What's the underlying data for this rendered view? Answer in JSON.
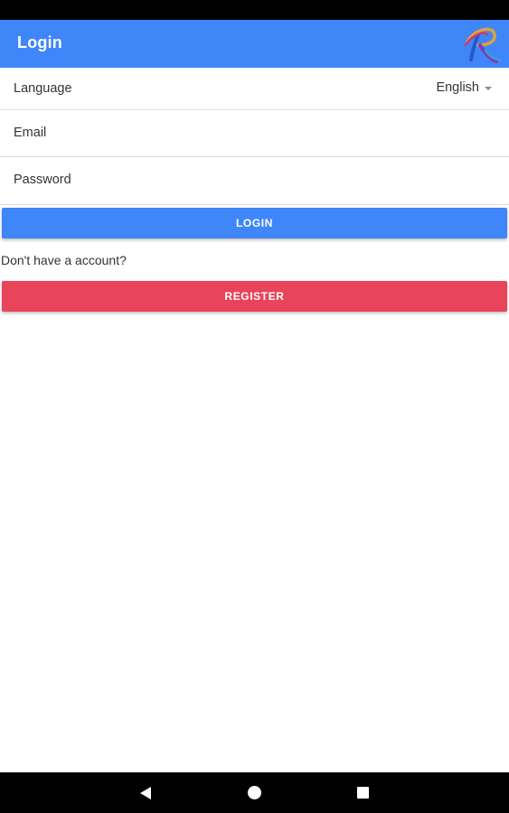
{
  "app_bar": {
    "title": "Login",
    "logo_icon": "app-logo-icon",
    "color": "#3f86f9"
  },
  "form": {
    "language": {
      "label": "Language",
      "selected": "English",
      "icon": "chevron-down-icon"
    },
    "email": {
      "label": "Email",
      "value": ""
    },
    "password": {
      "label": "Password",
      "value": ""
    },
    "login_button": {
      "label": "LOGIN",
      "color": "#3f86f9"
    },
    "register_prompt": "Don't have a account?",
    "register_button": {
      "label": "REGISTER",
      "color": "#e8445a"
    }
  },
  "nav_bar": {
    "back_icon": "back-triangle-icon",
    "home_icon": "home-circle-icon",
    "recents_icon": "recents-square-icon"
  }
}
